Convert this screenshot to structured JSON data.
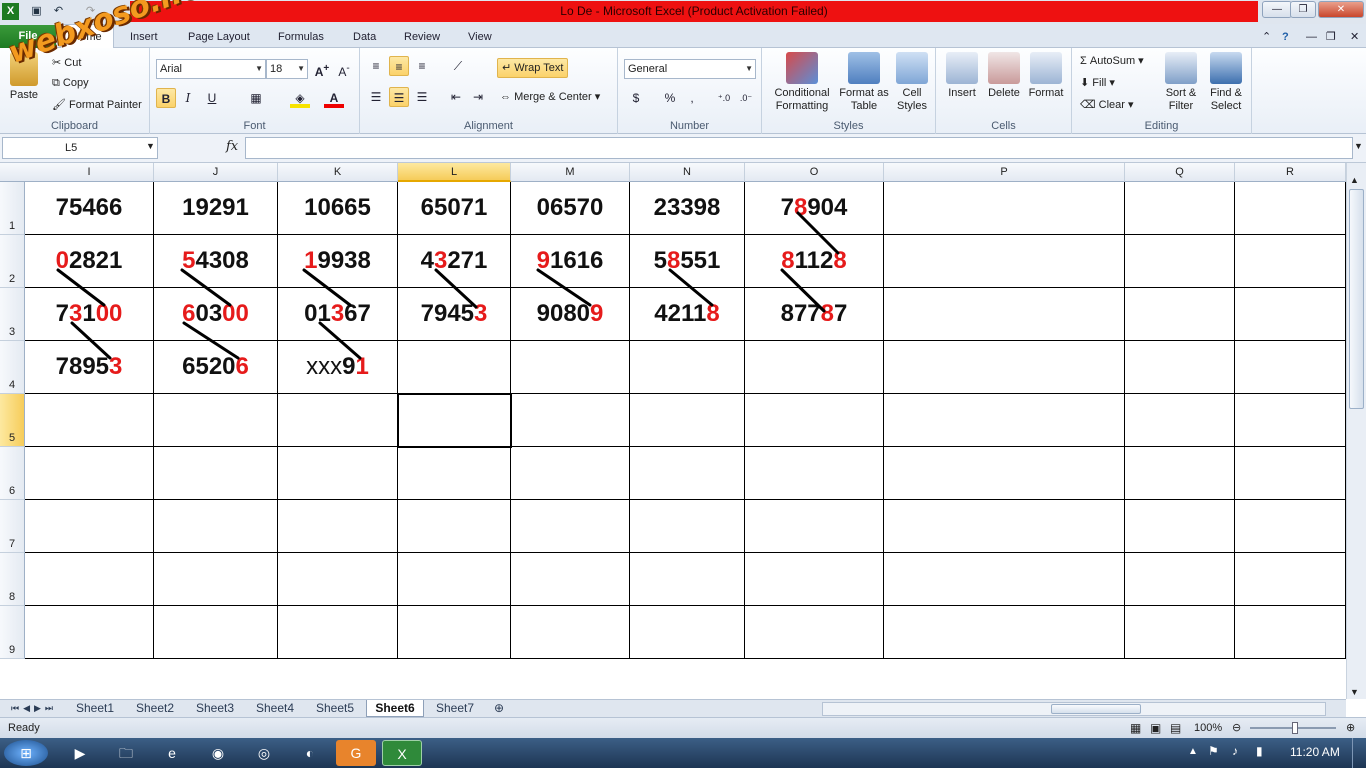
{
  "window": {
    "title": "Lo De  -  Microsoft Excel (Product Activation Failed)",
    "controls": [
      "—",
      "❐",
      "✕"
    ]
  },
  "watermark": "webxoso.net",
  "ribbon_tabs": [
    "File",
    "Home",
    "Insert",
    "Page Layout",
    "Formulas",
    "Data",
    "Review",
    "View"
  ],
  "clipboard": {
    "paste": "Paste",
    "cut": "Cut",
    "copy": "Copy",
    "format_painter": "Format Painter",
    "label": "Clipboard"
  },
  "font": {
    "name": "Arial",
    "size": "18",
    "label": "Font"
  },
  "alignment": {
    "wrap": "Wrap Text",
    "merge": "Merge & Center",
    "label": "Alignment"
  },
  "number": {
    "format": "General",
    "label": "Number",
    "currency": "$",
    "percent": "%",
    "comma": ","
  },
  "styles": {
    "conditional": "Conditional Formatting",
    "format_table": "Format as Table",
    "cell_styles": "Cell Styles",
    "label": "Styles"
  },
  "cells": {
    "insert": "Insert",
    "delete": "Delete",
    "format": "Format",
    "label": "Cells"
  },
  "editing": {
    "autosum": "AutoSum",
    "fill": "Fill",
    "clear": "Clear",
    "sort": "Sort & Filter",
    "find": "Find & Select",
    "label": "Editing"
  },
  "formula_bar": {
    "name_box": "L5",
    "fx": "fx",
    "value": ""
  },
  "columns": [
    "I",
    "J",
    "K",
    "L",
    "M",
    "N",
    "O",
    "P",
    "Q",
    "R"
  ],
  "rows": [
    "1",
    "2",
    "3",
    "4",
    "5",
    "6",
    "7",
    "8",
    "9"
  ],
  "cells_data": {
    "r1": [
      "75466",
      "19291",
      "10665",
      "65071",
      "06570",
      "23398",
      [
        [
          "7",
          ""
        ],
        [
          "8",
          "r"
        ],
        [
          "904",
          ""
        ]
      ]
    ],
    "r2": [
      [
        [
          "0",
          "r"
        ],
        [
          "2821",
          ""
        ]
      ],
      [
        [
          "5",
          "r"
        ],
        [
          "4308",
          ""
        ]
      ],
      [
        [
          "1",
          "r"
        ],
        [
          "9938",
          ""
        ]
      ],
      [
        [
          "4",
          ""
        ],
        [
          "3",
          "r"
        ],
        [
          "271",
          ""
        ]
      ],
      [
        [
          "9",
          "r"
        ],
        [
          "1616",
          ""
        ]
      ],
      [
        [
          "5",
          ""
        ],
        [
          "8",
          "r"
        ],
        [
          "551",
          ""
        ]
      ],
      [
        [
          "8",
          "r"
        ],
        [
          "112",
          ""
        ],
        [
          "8",
          "r"
        ]
      ]
    ],
    "r3": [
      [
        [
          "7",
          ""
        ],
        [
          "3",
          "r"
        ],
        [
          "1",
          ""
        ],
        [
          "00",
          "r"
        ]
      ],
      [
        [
          "6",
          "r"
        ],
        [
          "03",
          ""
        ],
        [
          "00",
          "r"
        ]
      ],
      [
        [
          "01",
          ""
        ],
        [
          "3",
          "r"
        ],
        [
          "6",
          ""
        ],
        [
          "7",
          ""
        ]
      ],
      [
        [
          "7945",
          ""
        ],
        [
          "3",
          "r"
        ]
      ],
      [
        [
          "9080",
          ""
        ],
        [
          "9",
          "r"
        ]
      ],
      [
        [
          "4211",
          ""
        ],
        [
          "8",
          "r"
        ]
      ],
      [
        [
          "877",
          ""
        ],
        [
          "8",
          "r"
        ],
        [
          "7",
          ""
        ]
      ]
    ],
    "r4": [
      [
        [
          "7895",
          ""
        ],
        [
          "3",
          "r"
        ]
      ],
      [
        [
          "6520",
          ""
        ],
        [
          "6",
          "r"
        ]
      ],
      [
        [
          "xxx",
          ""
        ],
        [
          "9",
          ""
        ],
        [
          "1",
          "r"
        ]
      ]
    ]
  },
  "sheets": [
    "Sheet1",
    "Sheet2",
    "Sheet3",
    "Sheet4",
    "Sheet5",
    "Sheet6",
    "Sheet7"
  ],
  "active_sheet": "Sheet6",
  "status": {
    "ready": "Ready",
    "zoom": "100%"
  },
  "clock": "11:20 AM"
}
